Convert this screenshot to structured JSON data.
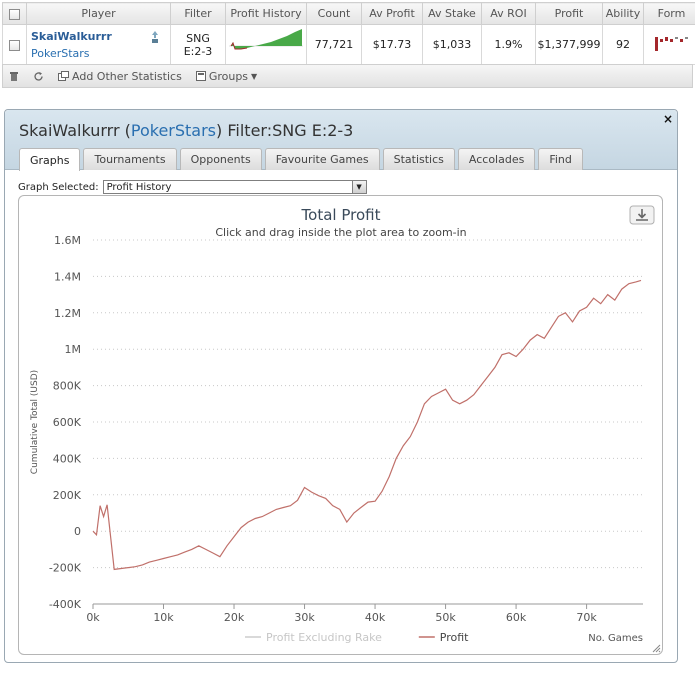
{
  "table": {
    "headers": [
      "Player",
      "Filter",
      "Profit History",
      "Count",
      "Av Profit",
      "Av Stake",
      "Av ROI",
      "Profit",
      "Ability",
      "Form"
    ],
    "row": {
      "player_name": "SkaiWalkurrr",
      "player_site": "PokerStars",
      "filter_line1": "SNG",
      "filter_line2": "E:2-3",
      "count": "77,721",
      "av_profit": "$17.73",
      "av_stake": "$1,033",
      "av_roi": "1.9%",
      "profit": "$1,377,999",
      "ability": "92",
      "extra": "≥"
    },
    "toolbar": {
      "add_stats": "Add Other Statistics",
      "groups": "Groups"
    }
  },
  "panel": {
    "title_name": "SkaiWalkurrr",
    "title_open": "(",
    "title_site": "PokerStars",
    "title_close": ")",
    "title_filter": "Filter:SNG E:2-3",
    "close": "×",
    "tabs": [
      "Graphs",
      "Tournaments",
      "Opponents",
      "Favourite Games",
      "Statistics",
      "Accolades",
      "Find"
    ],
    "active_tab": "Graphs",
    "graph_select_label": "Graph Selected:",
    "graph_selected": "Profit History",
    "chart_title": "Total Profit",
    "chart_subtitle": "Click and drag inside the plot area to zoom-in"
  },
  "chart_data": {
    "type": "line",
    "title": "Total Profit",
    "xlabel": "No. Games",
    "ylabel": "Cumulative Total (USD)",
    "xlim": [
      0,
      78000
    ],
    "ylim": [
      -400000,
      1600000
    ],
    "x_ticks": [
      0,
      10000,
      20000,
      30000,
      40000,
      50000,
      60000,
      70000
    ],
    "x_tick_labels": [
      "0k",
      "10k",
      "20k",
      "30k",
      "40k",
      "50k",
      "60k",
      "70k"
    ],
    "y_ticks": [
      -400000,
      -200000,
      0,
      200000,
      400000,
      600000,
      800000,
      1000000,
      1200000,
      1400000,
      1600000
    ],
    "y_tick_labels": [
      "-400K",
      "-200K",
      "0",
      "200K",
      "400K",
      "600K",
      "800K",
      "1M",
      "1.2M",
      "1.4M",
      "1.6M"
    ],
    "grid": true,
    "legend_position": "bottom",
    "series": [
      {
        "name": "Profit Excluding Rake",
        "color": "#cccccc",
        "x": [],
        "y": []
      },
      {
        "name": "Profit",
        "color": "#c0706a",
        "x": [
          0,
          500,
          1000,
          1500,
          2000,
          2500,
          3000,
          4000,
          5000,
          6000,
          7000,
          8000,
          9000,
          10000,
          11000,
          12000,
          13000,
          14000,
          15000,
          16000,
          17000,
          18000,
          19000,
          20000,
          21000,
          22000,
          23000,
          24000,
          25000,
          26000,
          27000,
          28000,
          29000,
          30000,
          31000,
          32000,
          33000,
          34000,
          35000,
          36000,
          37000,
          38000,
          39000,
          40000,
          41000,
          42000,
          43000,
          44000,
          45000,
          46000,
          47000,
          48000,
          49000,
          50000,
          51000,
          52000,
          53000,
          54000,
          55000,
          56000,
          57000,
          58000,
          59000,
          60000,
          61000,
          62000,
          63000,
          64000,
          65000,
          66000,
          67000,
          68000,
          69000,
          70000,
          71000,
          72000,
          73000,
          74000,
          75000,
          76000,
          77000,
          77721
        ],
        "y": [
          0,
          -20000,
          140000,
          80000,
          145000,
          -30000,
          -210000,
          -205000,
          -200000,
          -195000,
          -185000,
          -170000,
          -160000,
          -150000,
          -140000,
          -130000,
          -115000,
          -100000,
          -80000,
          -100000,
          -120000,
          -140000,
          -80000,
          -30000,
          20000,
          50000,
          70000,
          80000,
          100000,
          120000,
          130000,
          140000,
          170000,
          240000,
          215000,
          195000,
          180000,
          140000,
          120000,
          50000,
          100000,
          130000,
          160000,
          165000,
          220000,
          300000,
          400000,
          470000,
          520000,
          600000,
          700000,
          740000,
          760000,
          780000,
          720000,
          700000,
          720000,
          750000,
          800000,
          850000,
          900000,
          970000,
          980000,
          960000,
          1000000,
          1050000,
          1080000,
          1060000,
          1120000,
          1180000,
          1200000,
          1150000,
          1210000,
          1230000,
          1280000,
          1250000,
          1300000,
          1270000,
          1330000,
          1360000,
          1370000,
          1378000
        ]
      }
    ]
  },
  "icons": {
    "sparkline_color": "#49a948",
    "form_pos_color": "#a4282c",
    "form_neg_color": "#888888"
  }
}
